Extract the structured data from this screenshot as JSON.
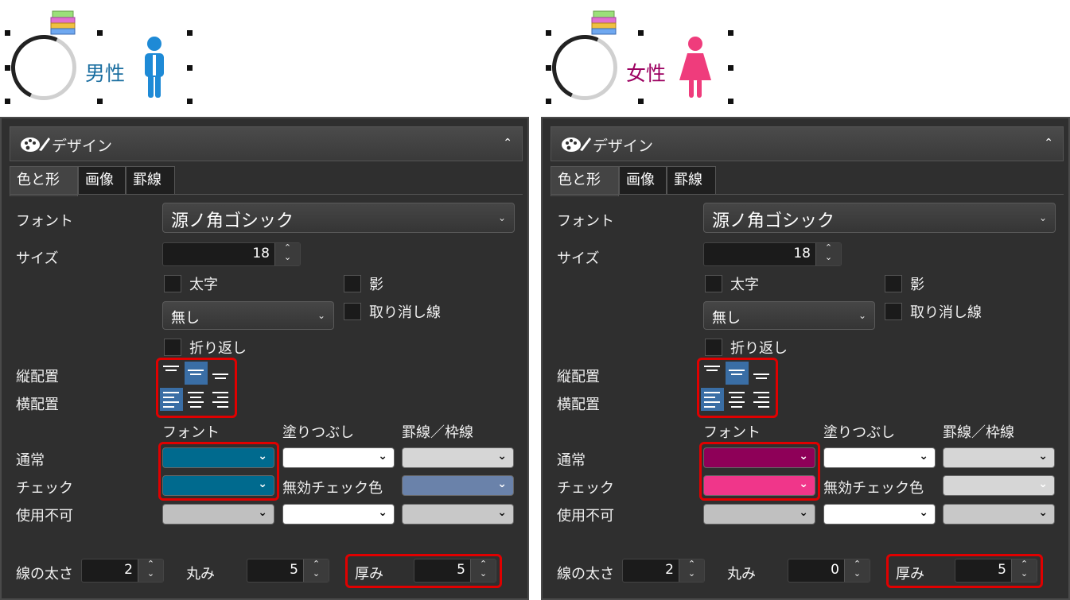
{
  "panels": [
    {
      "preview_label": "男性",
      "preview_label_color": "#1a6ea0",
      "person_icon": "male-icon",
      "person_color": "#1e8ad6",
      "header_title": "デザイン",
      "tabs": [
        "色と形",
        "画像",
        "罫線"
      ],
      "font_label": "フォント",
      "font_value": "源ノ角ゴシック",
      "size_label": "サイズ",
      "size_value": "18",
      "bold_label": "太字",
      "shadow_label": "影",
      "decoration_value": "無し",
      "strike_label": "取り消し線",
      "wrap_label": "折り返し",
      "valign_label": "縦配置",
      "halign_label": "横配置",
      "col_font": "フォント",
      "col_fill": "塗りつぶし",
      "col_border": "罫線／枠線",
      "row_normal": "通常",
      "row_check": "チェック",
      "row_disabled": "使用不可",
      "disabled_check_label": "無効チェック色",
      "colors": {
        "normal_font": "#006a8e",
        "normal_fill": "#ffffff",
        "normal_border": "#d6d6d6",
        "check_font": "#006a8e",
        "check_border": "#6a82aa",
        "disabled_font": "#c0c0c0",
        "disabled_fill": "#ffffff",
        "disabled_border": "#c8c8c8"
      },
      "line_width_label": "線の太さ",
      "line_width_value": "2",
      "round_label": "丸み",
      "round_value": "5",
      "thickness_label": "厚み",
      "thickness_value": "5"
    },
    {
      "preview_label": "女性",
      "preview_label_color": "#9c0060",
      "person_icon": "female-icon",
      "person_color": "#ef3c7c",
      "header_title": "デザイン",
      "tabs": [
        "色と形",
        "画像",
        "罫線"
      ],
      "font_label": "フォント",
      "font_value": "源ノ角ゴシック",
      "size_label": "サイズ",
      "size_value": "18",
      "bold_label": "太字",
      "shadow_label": "影",
      "decoration_value": "無し",
      "strike_label": "取り消し線",
      "wrap_label": "折り返し",
      "valign_label": "縦配置",
      "halign_label": "横配置",
      "col_font": "フォント",
      "col_fill": "塗りつぶし",
      "col_border": "罫線／枠線",
      "row_normal": "通常",
      "row_check": "チェック",
      "row_disabled": "使用不可",
      "disabled_check_label": "無効チェック色",
      "colors": {
        "normal_font": "#8e0058",
        "normal_fill": "#ffffff",
        "normal_border": "#d6d6d6",
        "check_font": "#f0368a",
        "check_border": "#d6d6d6",
        "disabled_font": "#c0c0c0",
        "disabled_fill": "#ffffff",
        "disabled_border": "#c8c8c8"
      },
      "line_width_label": "線の太さ",
      "line_width_value": "2",
      "round_label": "丸み",
      "round_value": "0",
      "thickness_label": "厚み",
      "thickness_value": "5"
    }
  ]
}
